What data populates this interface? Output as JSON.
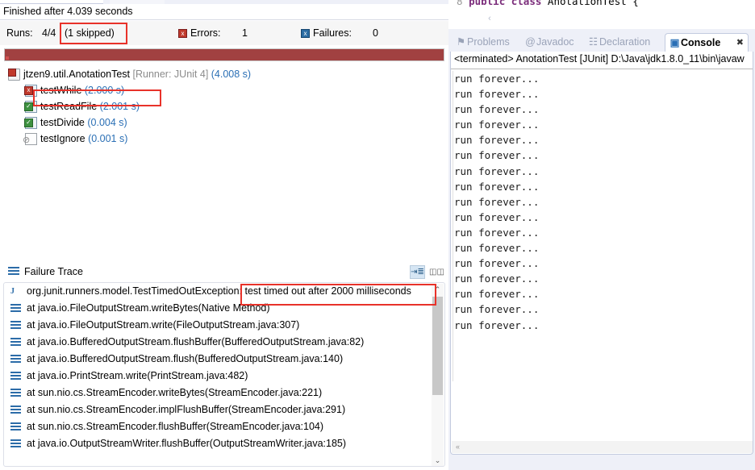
{
  "junit": {
    "finished_text": "Finished after 4.039 seconds",
    "stats": {
      "runs_label": "Runs:",
      "runs_value": "4/4",
      "skipped_value": "(1 skipped)",
      "errors_label": "Errors:",
      "errors_value": "1",
      "errors_icon": "error-x-icon",
      "failures_label": "Failures:",
      "failures_value": "0",
      "failures_icon": "failure-x-icon",
      "progress_color": "#a14141"
    },
    "tree": [
      {
        "icon": "test-class-failed-icon",
        "name": "jtzen9.util.AnotationTest",
        "runner": "[Runner: JUnit 4]",
        "time": "(4.008 s)",
        "twisty": "⌄",
        "indent": 29,
        "icon_class": "ic-class"
      },
      {
        "icon": "test-failed-icon",
        "name": "testWhile",
        "runner": "",
        "time": "(2.000 s)",
        "twisty": "",
        "indent": 50,
        "icon_class": "ic-test-fail"
      },
      {
        "icon": "test-passed-icon",
        "name": "testReadFile",
        "runner": "",
        "time": "(2.001 s)",
        "twisty": "",
        "indent": 50,
        "icon_class": "ic-test-pass"
      },
      {
        "icon": "test-passed-icon",
        "name": "testDivide",
        "runner": "",
        "time": "(0.004 s)",
        "twisty": "",
        "indent": 50,
        "icon_class": "ic-test-pass"
      },
      {
        "icon": "test-ignored-icon",
        "name": "testIgnore",
        "runner": "",
        "time": "(0.001 s)",
        "twisty": "",
        "indent": 50,
        "icon_class": "ic-test-ignore"
      }
    ],
    "failure_trace": {
      "title": "Failure Trace",
      "tool_1": "filter-stack-trace-icon",
      "tool_2": "view-menu-icon",
      "rows": [
        {
          "icon": "exception-icon",
          "text": "org.junit.runners.model.TestTimedOutException: test timed out after 2000 milliseconds"
        },
        {
          "icon": "stack-frame-icon",
          "text": "at java.io.FileOutputStream.writeBytes(Native Method)"
        },
        {
          "icon": "stack-frame-icon",
          "text": "at java.io.FileOutputStream.write(FileOutputStream.java:307)"
        },
        {
          "icon": "stack-frame-icon",
          "text": "at java.io.BufferedOutputStream.flushBuffer(BufferedOutputStream.java:82)"
        },
        {
          "icon": "stack-frame-icon",
          "text": "at java.io.BufferedOutputStream.flush(BufferedOutputStream.java:140)"
        },
        {
          "icon": "stack-frame-icon",
          "text": "at java.io.PrintStream.write(PrintStream.java:482)"
        },
        {
          "icon": "stack-frame-icon",
          "text": "at sun.nio.cs.StreamEncoder.writeBytes(StreamEncoder.java:221)"
        },
        {
          "icon": "stack-frame-icon",
          "text": "at sun.nio.cs.StreamEncoder.implFlushBuffer(StreamEncoder.java:291)"
        },
        {
          "icon": "stack-frame-icon",
          "text": "at sun.nio.cs.StreamEncoder.flushBuffer(StreamEncoder.java:104)"
        },
        {
          "icon": "stack-frame-icon",
          "text": "at java.io.OutputStreamWriter.flushBuffer(OutputStreamWriter.java:185)"
        }
      ],
      "scroll_up": "⌃",
      "scroll_down": "⌄"
    }
  },
  "editor": {
    "line_number": "8",
    "keyword_1": "public",
    "keyword_2": "class",
    "class_name": "AnotationTest {",
    "scroll_left_arrow": "‹"
  },
  "console": {
    "tabs": [
      {
        "label": "Problems",
        "icon": "problems-icon",
        "icon_glyph": "⚑",
        "active": false
      },
      {
        "label": "Javadoc",
        "icon": "javadoc-icon",
        "icon_glyph": "@",
        "active": false
      },
      {
        "label": "Declaration",
        "icon": "declaration-icon",
        "icon_glyph": "☷",
        "active": false
      },
      {
        "label": "Console",
        "icon": "console-icon",
        "icon_glyph": "▣",
        "active": true
      }
    ],
    "close_glyph": "✖",
    "terminated_line": "<terminated> AnotationTest [JUnit] D:\\Java\\jdk1.8.0_11\\bin\\javaw",
    "output_line": "run forever...",
    "output_line_count": 17,
    "hscroll_arrow": "«"
  }
}
